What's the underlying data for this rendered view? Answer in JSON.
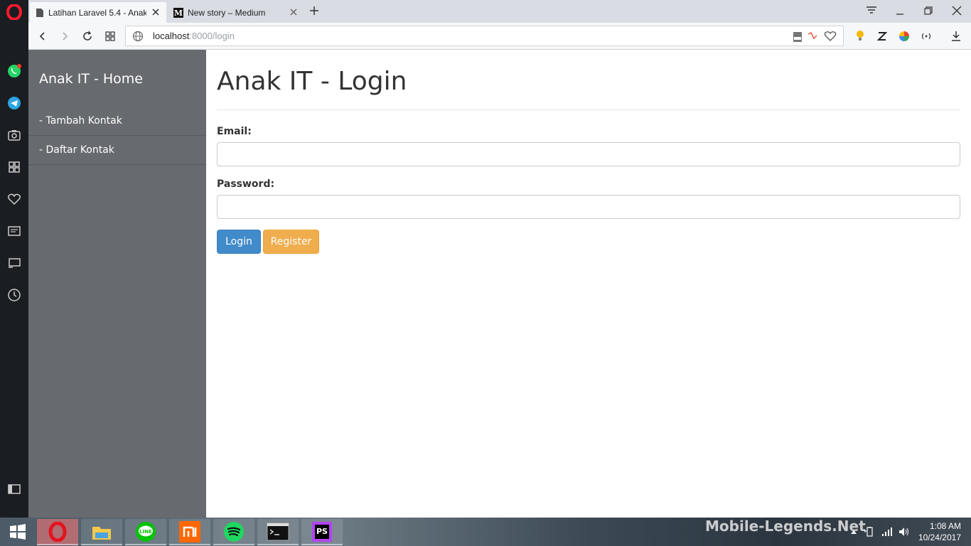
{
  "browser": {
    "tabs": [
      {
        "title": "Latihan Laravel 5.4 - Anak",
        "active": true
      },
      {
        "title": "New story – Medium",
        "active": false
      }
    ],
    "url_host": "localhost",
    "url_path": ":8000/login"
  },
  "sidebar": {
    "brand": "Anak IT - Home",
    "items": [
      {
        "label": "- Tambah Kontak"
      },
      {
        "label": "- Daftar Kontak"
      }
    ]
  },
  "login": {
    "title": "Anak IT - Login",
    "email_label": "Email:",
    "email_value": "",
    "password_label": "Password:",
    "password_value": "",
    "login_button": "Login",
    "register_button": "Register"
  },
  "taskbar": {
    "watermark": "Mobile-Legends.Net",
    "time": "1:08 AM",
    "date": "10/24/2017",
    "apps": [
      "opera",
      "file-explorer",
      "line",
      "mi",
      "spotify",
      "cmd",
      "phpstorm"
    ]
  },
  "colors": {
    "sidebar_bg": "#676a6f",
    "primary": "#428bca",
    "warning": "#f0ad4e"
  }
}
